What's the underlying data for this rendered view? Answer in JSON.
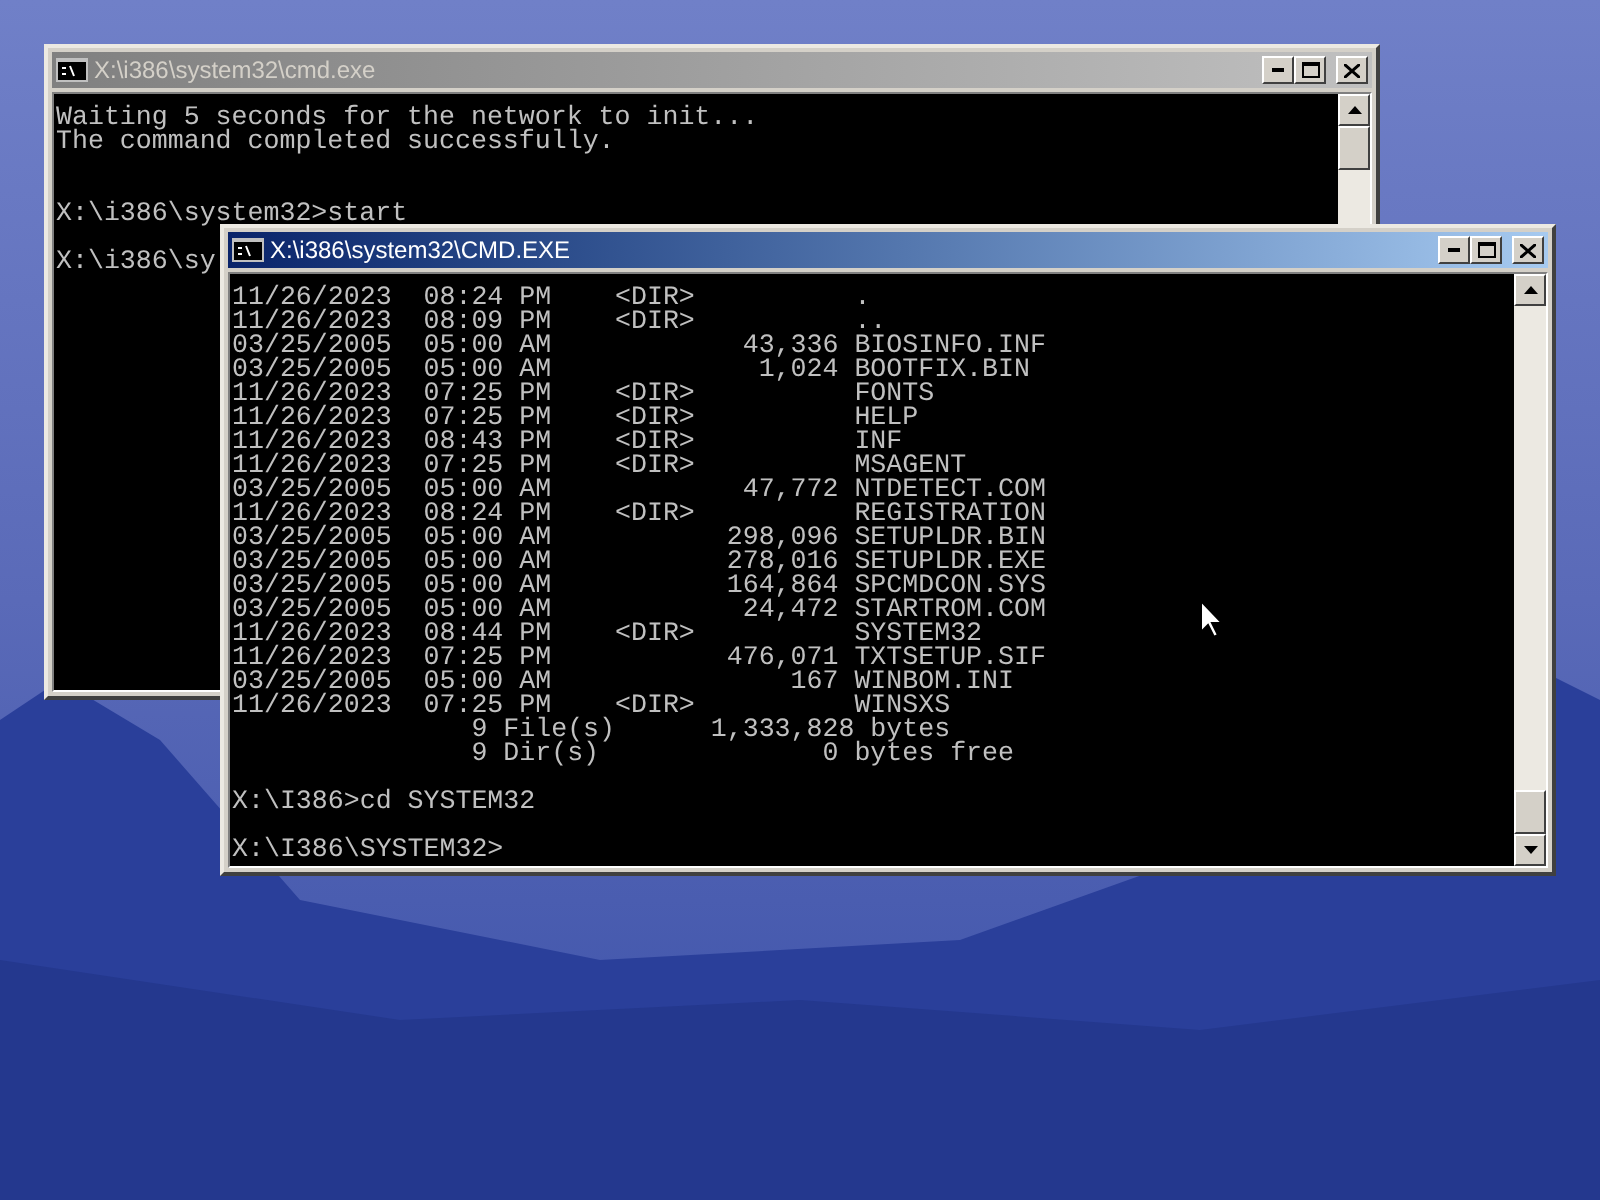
{
  "windows": [
    {
      "title": "X:\\i386\\system32\\cmd.exe",
      "active": false,
      "blocks": [
        {
          "lines": [
            "Waiting 5 seconds for the network to init...",
            "The command completed successfully."
          ]
        },
        {
          "lines": [
            "X:\\i386\\system32>start"
          ]
        },
        {
          "lines": [
            "X:\\i386\\sy"
          ]
        }
      ]
    },
    {
      "title": "X:\\i386\\system32\\CMD.EXE",
      "active": true,
      "blocks": [
        {
          "lines": [
            "11/26/2023  08:24 PM    <DIR>          .",
            "11/26/2023  08:09 PM    <DIR>          ..",
            "03/25/2005  05:00 AM            43,336 BIOSINFO.INF",
            "03/25/2005  05:00 AM             1,024 BOOTFIX.BIN",
            "11/26/2023  07:25 PM    <DIR>          FONTS",
            "11/26/2023  07:25 PM    <DIR>          HELP",
            "11/26/2023  08:43 PM    <DIR>          INF",
            "11/26/2023  07:25 PM    <DIR>          MSAGENT",
            "03/25/2005  05:00 AM            47,772 NTDETECT.COM",
            "11/26/2023  08:24 PM    <DIR>          REGISTRATION",
            "03/25/2005  05:00 AM           298,096 SETUPLDR.BIN",
            "03/25/2005  05:00 AM           278,016 SETUPLDR.EXE",
            "03/25/2005  05:00 AM           164,864 SPCMDCON.SYS",
            "03/25/2005  05:00 AM            24,472 STARTROM.COM",
            "11/26/2023  08:44 PM    <DIR>          SYSTEM32",
            "11/26/2023  07:25 PM           476,071 TXTSETUP.SIF",
            "03/25/2005  05:00 AM               167 WINBOM.INI",
            "11/26/2023  07:25 PM    <DIR>          WINSXS",
            "               9 File(s)      1,333,828 bytes",
            "               9 Dir(s)              0 bytes free"
          ]
        },
        {
          "lines": [
            "X:\\I386>cd SYSTEM32"
          ]
        },
        {
          "lines": [
            "X:\\I386\\SYSTEM32>"
          ]
        }
      ]
    }
  ]
}
